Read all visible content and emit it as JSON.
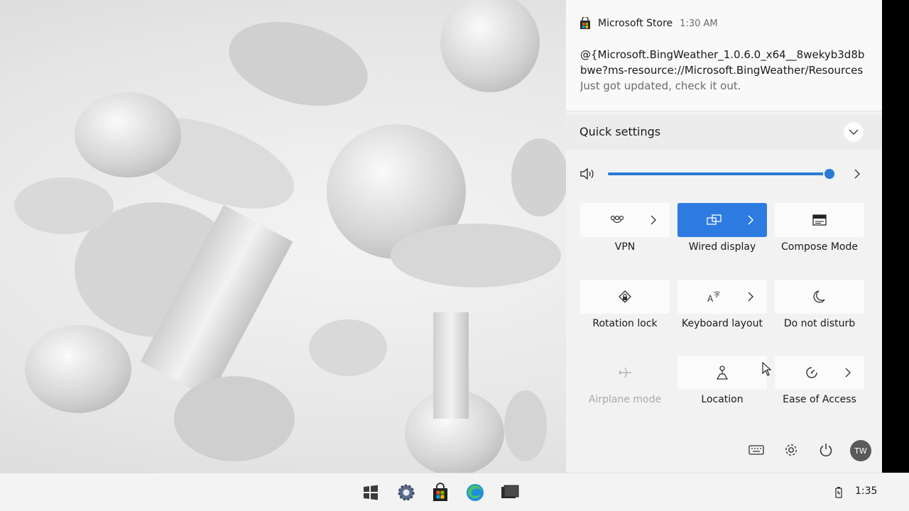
{
  "notification": {
    "app": "Microsoft Store",
    "time": "1:30 AM",
    "line1": "@{Microsoft.BingWeather_1.0.6.0_x64__8wekyb3d8b",
    "line2": "bwe?ms-resource://Microsoft.BingWeather/Resources",
    "line3": "Just got updated, check it out."
  },
  "quick_settings": {
    "title": "Quick settings",
    "volume_percent": 100,
    "tiles": [
      {
        "label": "VPN",
        "icon": "vpn-icon",
        "active": false,
        "disabled": false,
        "chevron": true
      },
      {
        "label": "Wired display",
        "icon": "wired-display-icon",
        "active": true,
        "disabled": false,
        "chevron": true
      },
      {
        "label": "Compose Mode",
        "icon": "compose-mode-icon",
        "active": false,
        "disabled": false,
        "chevron": false
      },
      {
        "label": "Rotation lock",
        "icon": "rotation-lock-icon",
        "active": false,
        "disabled": false,
        "chevron": false
      },
      {
        "label": "Keyboard layout",
        "icon": "keyboard-layout-icon",
        "active": false,
        "disabled": false,
        "chevron": true
      },
      {
        "label": "Do not disturb",
        "icon": "moon-icon",
        "active": false,
        "disabled": false,
        "chevron": false
      },
      {
        "label": "Airplane mode",
        "icon": "airplane-icon",
        "active": false,
        "disabled": true,
        "chevron": false
      },
      {
        "label": "Location",
        "icon": "location-icon",
        "active": false,
        "disabled": false,
        "chevron": false
      },
      {
        "label": "Ease of Access",
        "icon": "ease-of-access-icon",
        "active": false,
        "disabled": false,
        "chevron": true
      }
    ],
    "avatar_initials": "TW"
  },
  "taskbar": {
    "clock": "1:35",
    "icons": [
      "windows-start-icon",
      "settings-icon",
      "store-icon",
      "edge-icon",
      "task-view-icon"
    ]
  },
  "colors": {
    "accent": "#2d7be0",
    "panel_bg": "#f2f2f2"
  }
}
